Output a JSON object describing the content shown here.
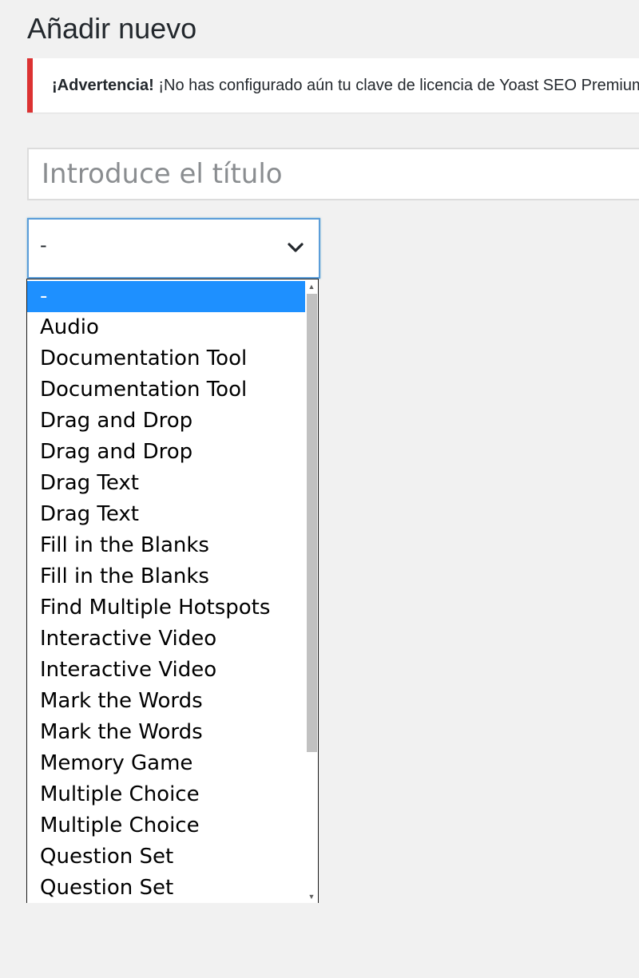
{
  "header": {
    "title": "Añadir nuevo"
  },
  "notice": {
    "strong": "¡Advertencia!",
    "text": "¡No has configurado aún tu clave de licencia de Yoast SEO Premium"
  },
  "title_input": {
    "placeholder": "Introduce el título",
    "value": ""
  },
  "content_type_select": {
    "selected_value": "-",
    "options": [
      "-",
      "Audio",
      "Documentation Tool",
      "Documentation Tool",
      "Drag and Drop",
      "Drag and Drop",
      "Drag Text",
      "Drag Text",
      "Fill in the Blanks",
      "Fill in the Blanks",
      "Find Multiple Hotspots",
      "Interactive Video",
      "Interactive Video",
      "Mark the Words",
      "Mark the Words",
      "Memory Game",
      "Multiple Choice",
      "Multiple Choice",
      "Question Set",
      "Question Set"
    ],
    "highlighted_index": 0
  },
  "icons": {
    "select_chevron": "chevron-down-icon",
    "scroll_up": "scroll-up-arrow-icon",
    "scroll_down": "scroll-down-arrow-icon"
  },
  "colors": {
    "background": "#f1f1f1",
    "notice_border": "#dc3232",
    "focus_border": "#5b9dd9",
    "highlight": "#1e90ff",
    "scroll_thumb": "#c1c1c1"
  }
}
